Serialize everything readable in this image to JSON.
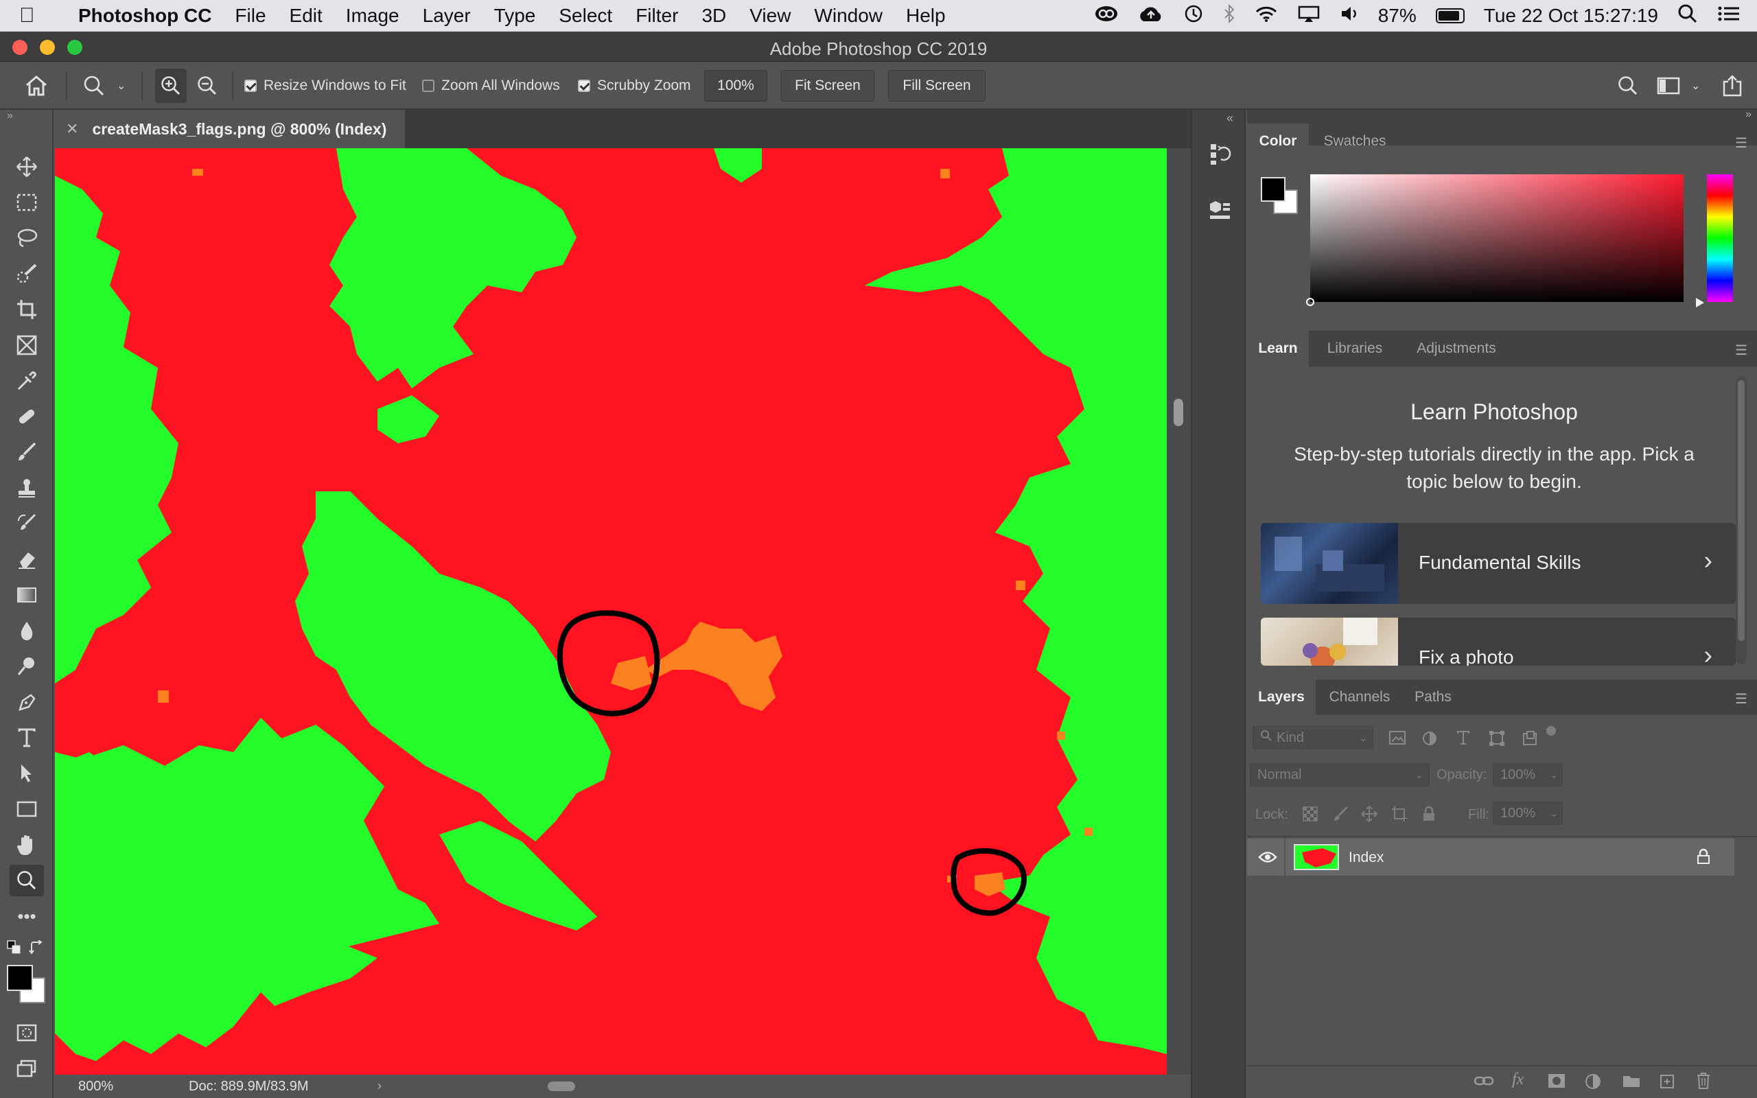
{
  "menubar": {
    "app_name": "Photoshop CC",
    "items": [
      "File",
      "Edit",
      "Image",
      "Layer",
      "Type",
      "Select",
      "Filter",
      "3D",
      "View",
      "Window",
      "Help"
    ],
    "battery_percent": "87%",
    "battery_level": 0.87,
    "datetime": "Tue 22 Oct  15:27:19"
  },
  "window": {
    "title": "Adobe Photoshop CC 2019"
  },
  "options": {
    "resize_windows_label": "Resize Windows to Fit",
    "resize_windows_checked": true,
    "zoom_all_label": "Zoom All Windows",
    "zoom_all_checked": false,
    "scrubby_label": "Scrubby Zoom",
    "scrubby_checked": true,
    "zoom_value": "100%",
    "fit_screen_label": "Fit Screen",
    "fill_screen_label": "Fill Screen"
  },
  "document": {
    "tab_title": "createMask3_flags.png @ 800% (Index)",
    "zoom": "800%",
    "doc_size": "Doc: 889.9M/83.9M"
  },
  "canvas": {
    "colors": {
      "background": "#ff1320",
      "region": "#24fb2a",
      "flag": "#fb8020",
      "annotation": "#000000"
    }
  },
  "color_panel": {
    "tabs": [
      "Color",
      "Swatches"
    ],
    "active_tab": "Color",
    "foreground": "#000000",
    "background": "#ffffff"
  },
  "learn_panel": {
    "tabs": [
      "Learn",
      "Libraries",
      "Adjustments"
    ],
    "active_tab": "Learn",
    "heading": "Learn Photoshop",
    "description": "Step-by-step tutorials directly in the app. Pick a topic below to begin.",
    "cards": [
      {
        "label": "Fundamental Skills"
      },
      {
        "label": "Fix a photo"
      }
    ]
  },
  "layers_panel": {
    "tabs": [
      "Layers",
      "Channels",
      "Paths"
    ],
    "active_tab": "Layers",
    "filter_kind": "Kind",
    "blend_mode": "Normal",
    "opacity_label": "Opacity:",
    "opacity_value": "100%",
    "lock_label": "Lock:",
    "fill_label": "Fill:",
    "fill_value": "100%",
    "layers": [
      {
        "name": "Index",
        "visible": true,
        "locked": true
      }
    ]
  }
}
